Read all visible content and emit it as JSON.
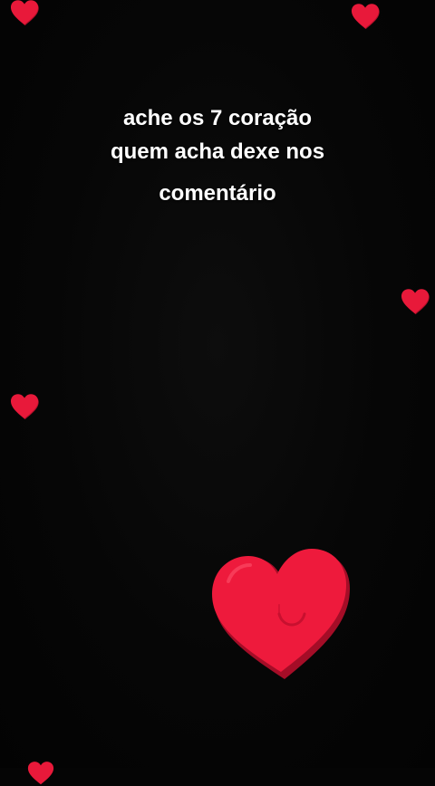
{
  "caption": {
    "line1": "ache os 7 coração",
    "line2": "quem acha dexe nos",
    "line3": "comentário"
  },
  "colors": {
    "background": "#050505",
    "heart_fill": "#e8193a",
    "heart_shadow": "#b30f2a",
    "text": "#ffffff"
  },
  "icons": [
    "heart-icon"
  ]
}
